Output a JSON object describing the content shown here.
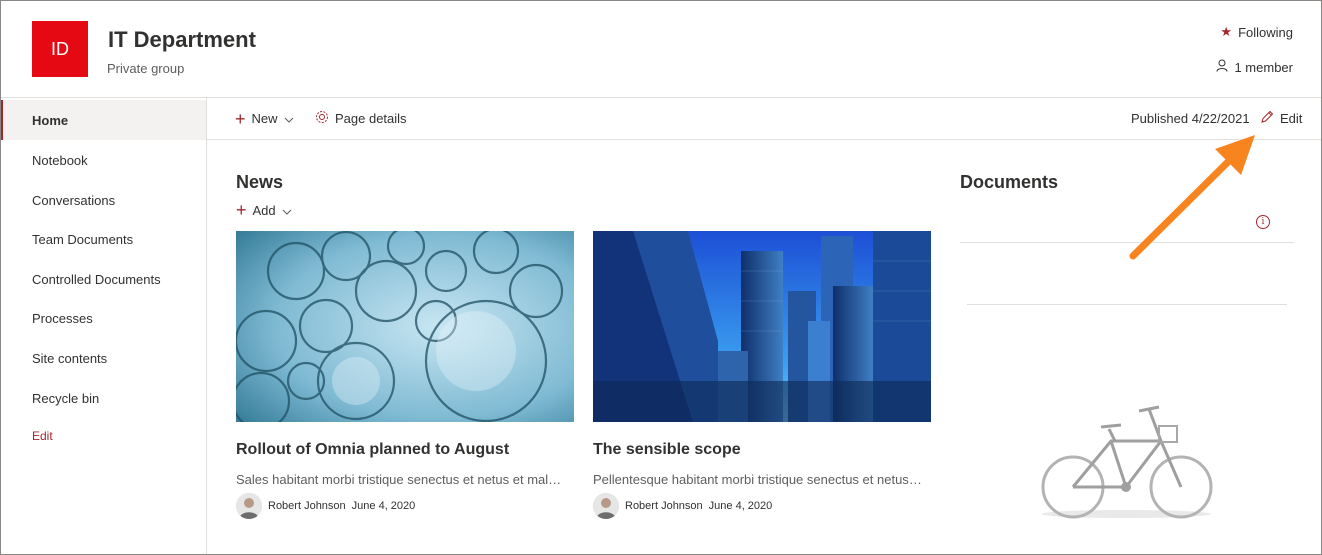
{
  "header": {
    "logo_text": "ID",
    "title": "IT Department",
    "subtitle": "Private group",
    "following_label": "Following",
    "members_label": "1 member"
  },
  "nav": {
    "items": [
      {
        "label": "Home",
        "active": true
      },
      {
        "label": "Notebook"
      },
      {
        "label": "Conversations"
      },
      {
        "label": "Team Documents"
      },
      {
        "label": "Controlled Documents"
      },
      {
        "label": "Processes"
      },
      {
        "label": "Site contents"
      },
      {
        "label": "Recycle bin"
      }
    ],
    "edit_label": "Edit"
  },
  "commandbar": {
    "new_label": "New",
    "page_details_label": "Page details",
    "published": "Published 4/22/2021",
    "edit_label": "Edit"
  },
  "news": {
    "title": "News",
    "add_label": "Add",
    "cards": [
      {
        "title": "Rollout of Omnia planned to August",
        "description": "Sales habitant morbi tristique senectus et netus et malesuada fames",
        "author": "Robert Johnson",
        "date": "June 4, 2020"
      },
      {
        "title": "The sensible scope",
        "description": "Pellentesque habitant morbi tristique senectus et netus et malesuada",
        "author": "Robert Johnson",
        "date": "June 4, 2020"
      }
    ]
  },
  "documents": {
    "title": "Documents"
  },
  "colors": {
    "accent": "#a4262c",
    "logo_bg": "#e50914",
    "arrow": "#f7841f"
  }
}
